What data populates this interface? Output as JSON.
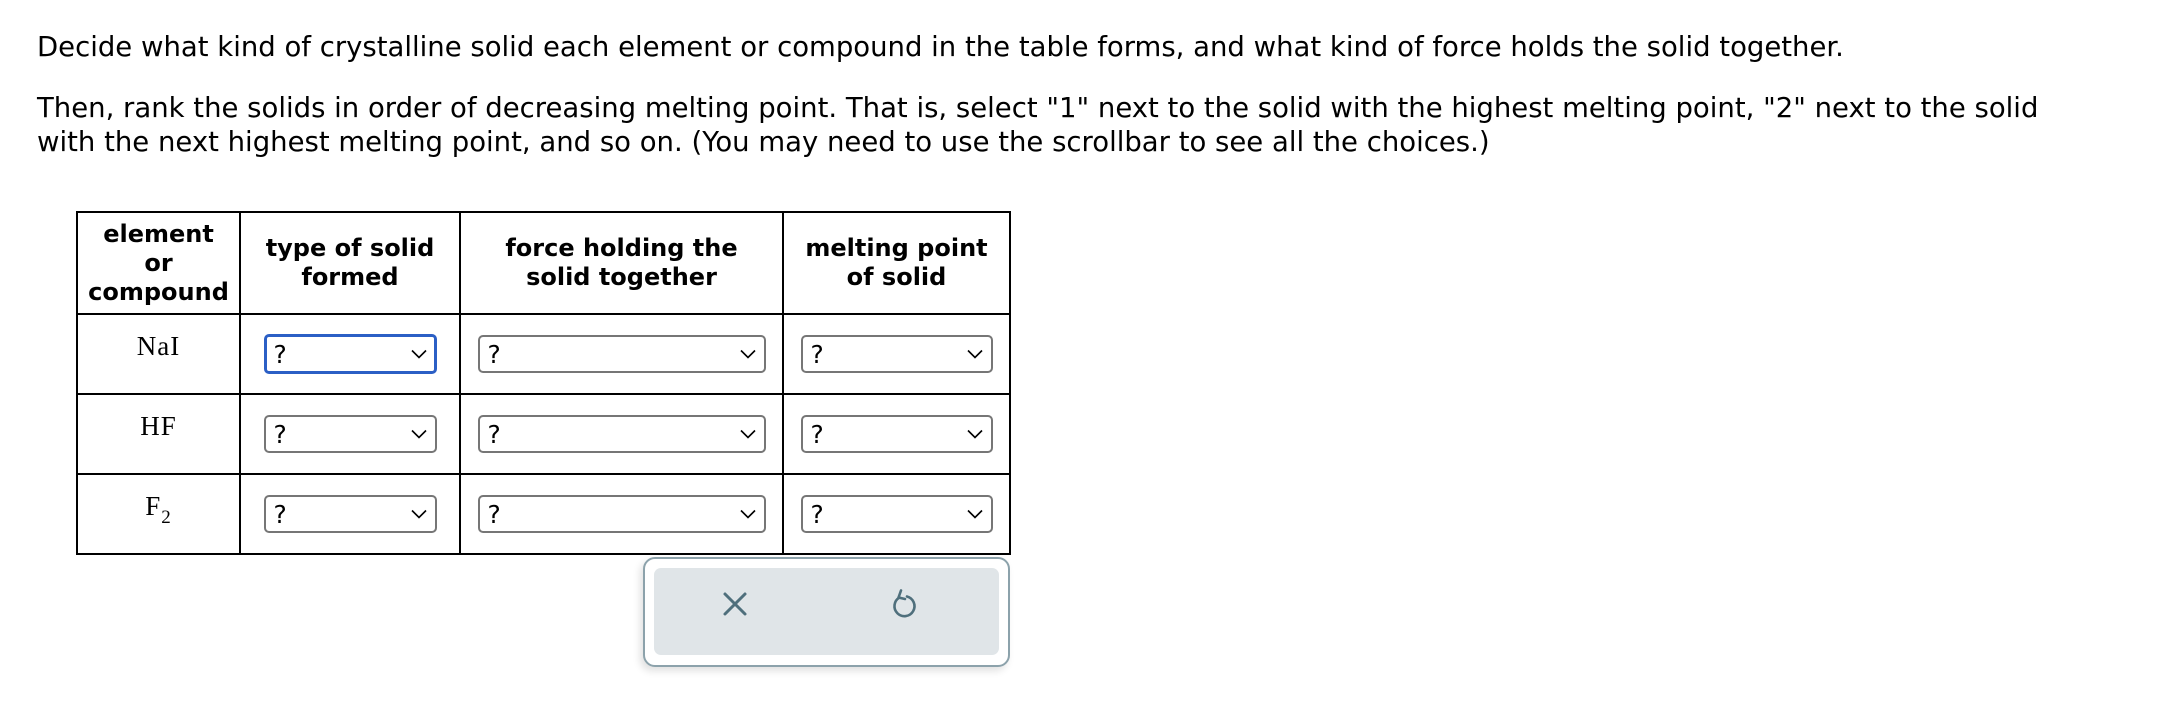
{
  "instructions": {
    "paragraph1": "Decide what kind of crystalline solid each element or compound in the table forms, and what kind of force holds the solid together.",
    "paragraph2_line1": "Then, rank the solids in order of decreasing melting point. That is, select \"1\" next to the solid with the highest melting point, \"2\" next to the solid",
    "paragraph2_line2": "with the next highest melting point, and so on. (You may need to use the scrollbar to see all the choices.)"
  },
  "table": {
    "headers": [
      [
        "element",
        "or",
        "compound"
      ],
      [
        "type of solid",
        "formed"
      ],
      [
        "force holding the",
        "solid together"
      ],
      [
        "melting point",
        "of solid"
      ]
    ],
    "rows": [
      {
        "formula": "NaI",
        "subscript": "",
        "type_of_solid": "?",
        "force": "?",
        "melting_point": "?"
      },
      {
        "formula": "HF",
        "subscript": "",
        "type_of_solid": "?",
        "force": "?",
        "melting_point": "?"
      },
      {
        "formula": "F",
        "subscript": "2",
        "type_of_solid": "?",
        "force": "?",
        "melting_point": "?"
      }
    ]
  },
  "actions": {
    "clear_icon": "close-icon",
    "reset_icon": "undo-icon"
  },
  "colors": {
    "focus_border": "#2b5fc5",
    "panel_bg": "#e0e5e8",
    "panel_border": "#8ca2ab",
    "icon": "#4f6f7c"
  }
}
